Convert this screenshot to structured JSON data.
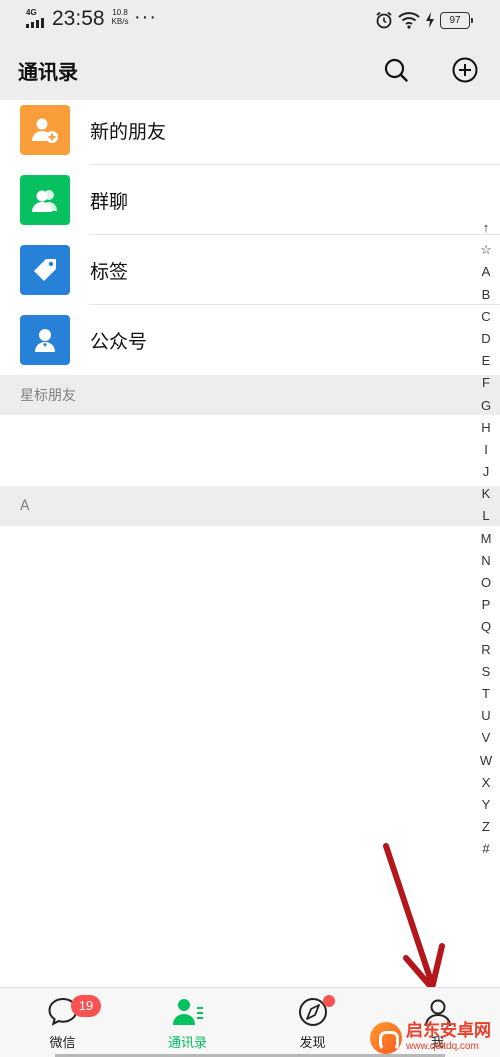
{
  "status_bar": {
    "network": "4G",
    "time": "23:58",
    "speed_value": "10.8",
    "speed_unit": "KB/s",
    "more": "···",
    "battery": "97"
  },
  "header": {
    "title": "通讯录",
    "search_icon": "search-icon",
    "add_icon": "plus-circle-icon"
  },
  "top_items": [
    {
      "label": "新的朋友",
      "color": "#fa9d3b",
      "icon": "add-friend-icon"
    },
    {
      "label": "群聊",
      "color": "#07c160",
      "icon": "group-icon"
    },
    {
      "label": "标签",
      "color": "#2782d7",
      "icon": "tag-icon"
    },
    {
      "label": "公众号",
      "color": "#2782d7",
      "icon": "official-account-icon"
    }
  ],
  "sections": [
    {
      "title": "星标朋友"
    },
    {
      "title": "A"
    }
  ],
  "alphabet_index": [
    "↑",
    "☆",
    "A",
    "B",
    "C",
    "D",
    "E",
    "F",
    "G",
    "H",
    "I",
    "J",
    "K",
    "L",
    "M",
    "N",
    "O",
    "P",
    "Q",
    "R",
    "S",
    "T",
    "U",
    "V",
    "W",
    "X",
    "Y",
    "Z",
    "#"
  ],
  "tabs": [
    {
      "label": "微信",
      "icon": "chat-icon",
      "badge": "19"
    },
    {
      "label": "通讯录",
      "icon": "contacts-icon",
      "active": true
    },
    {
      "label": "发现",
      "icon": "compass-icon",
      "dot": true
    },
    {
      "label": "我",
      "icon": "me-icon"
    }
  ],
  "colors": {
    "accent": "#07c160",
    "badge": "#fa5151",
    "arrow": "#b3161b"
  },
  "watermark": {
    "title": "启东安卓网",
    "url": "www.qdltdq.com"
  }
}
